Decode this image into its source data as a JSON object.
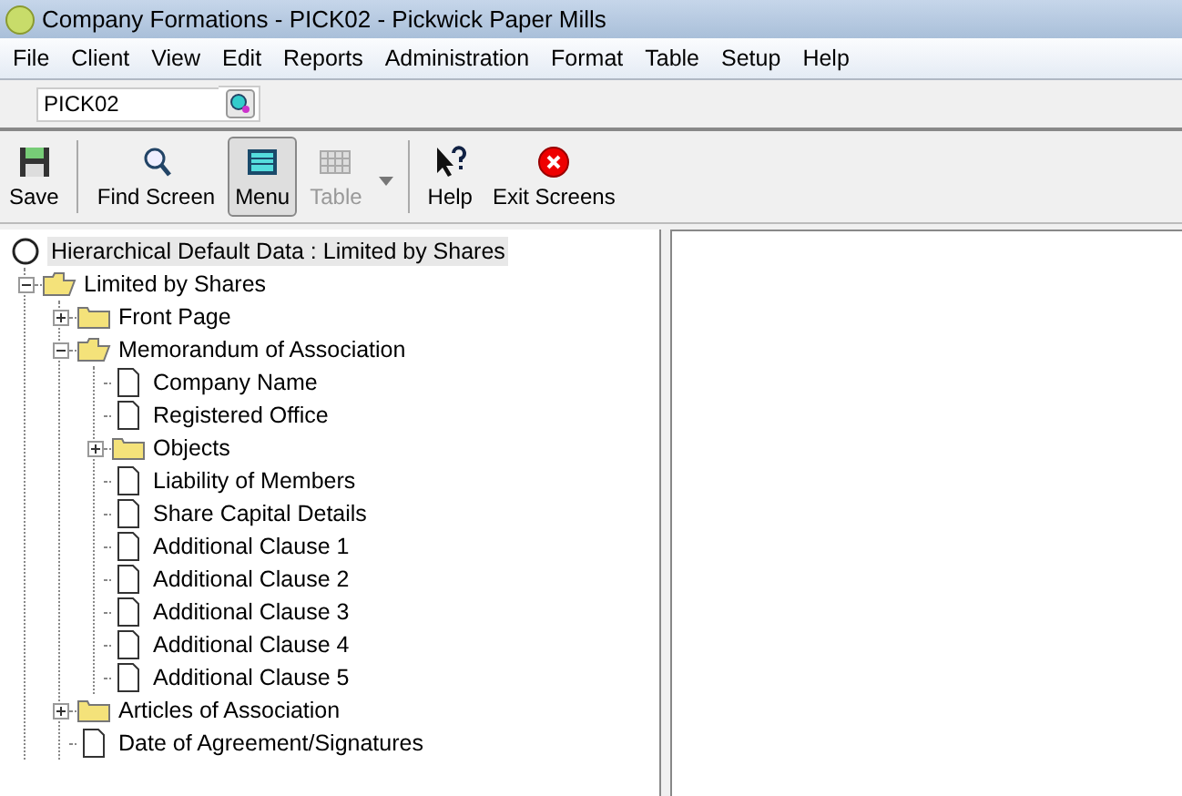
{
  "window": {
    "title": "Company Formations - PICK02 - Pickwick Paper Mills"
  },
  "menu": [
    "File",
    "Client",
    "View",
    "Edit",
    "Reports",
    "Administration",
    "Format",
    "Table",
    "Setup",
    "Help"
  ],
  "client_field": {
    "value": "PICK02"
  },
  "toolbar": [
    {
      "kind": "save",
      "label": "Save",
      "pressed": false,
      "disabled": false
    },
    {
      "kind": "find",
      "label": "Find Screen",
      "pressed": false,
      "disabled": false
    },
    {
      "kind": "menu",
      "label": "Menu",
      "pressed": true,
      "disabled": false
    },
    {
      "kind": "table",
      "label": "Table",
      "pressed": false,
      "disabled": true,
      "dropdown": true
    },
    {
      "kind": "help",
      "label": "Help",
      "pressed": false,
      "disabled": false
    },
    {
      "kind": "exit",
      "label": "Exit Screens",
      "pressed": false,
      "disabled": false
    }
  ],
  "tree": {
    "label": "Hierarchical Default Data : Limited by Shares",
    "selected": true,
    "children": [
      {
        "label": "Limited by Shares",
        "kind": "folder",
        "expanded": true,
        "selected": false,
        "children": [
          {
            "label": "Front Page",
            "kind": "folder",
            "expanded": false,
            "selected": false
          },
          {
            "label": "Memorandum of Association",
            "kind": "folder",
            "expanded": true,
            "selected": false,
            "children": [
              {
                "label": "Company Name",
                "kind": "document",
                "selected": false
              },
              {
                "label": "Registered Office",
                "kind": "document",
                "selected": false
              },
              {
                "label": "Objects",
                "kind": "folder",
                "expanded": false,
                "selected": false
              },
              {
                "label": "Liability of Members",
                "kind": "document",
                "selected": false
              },
              {
                "label": "Share Capital Details",
                "kind": "document",
                "selected": false
              },
              {
                "label": "Additional Clause 1",
                "kind": "document",
                "selected": false
              },
              {
                "label": "Additional Clause 2",
                "kind": "document",
                "selected": false
              },
              {
                "label": "Additional Clause 3",
                "kind": "document",
                "selected": false
              },
              {
                "label": "Additional Clause 4",
                "kind": "document",
                "selected": false
              },
              {
                "label": "Additional Clause 5",
                "kind": "document",
                "selected": false
              }
            ]
          },
          {
            "label": "Articles of Association",
            "kind": "folder",
            "expanded": false,
            "selected": false
          },
          {
            "label": "Date of Agreement/Signatures",
            "kind": "document",
            "selected": false
          }
        ]
      }
    ]
  }
}
